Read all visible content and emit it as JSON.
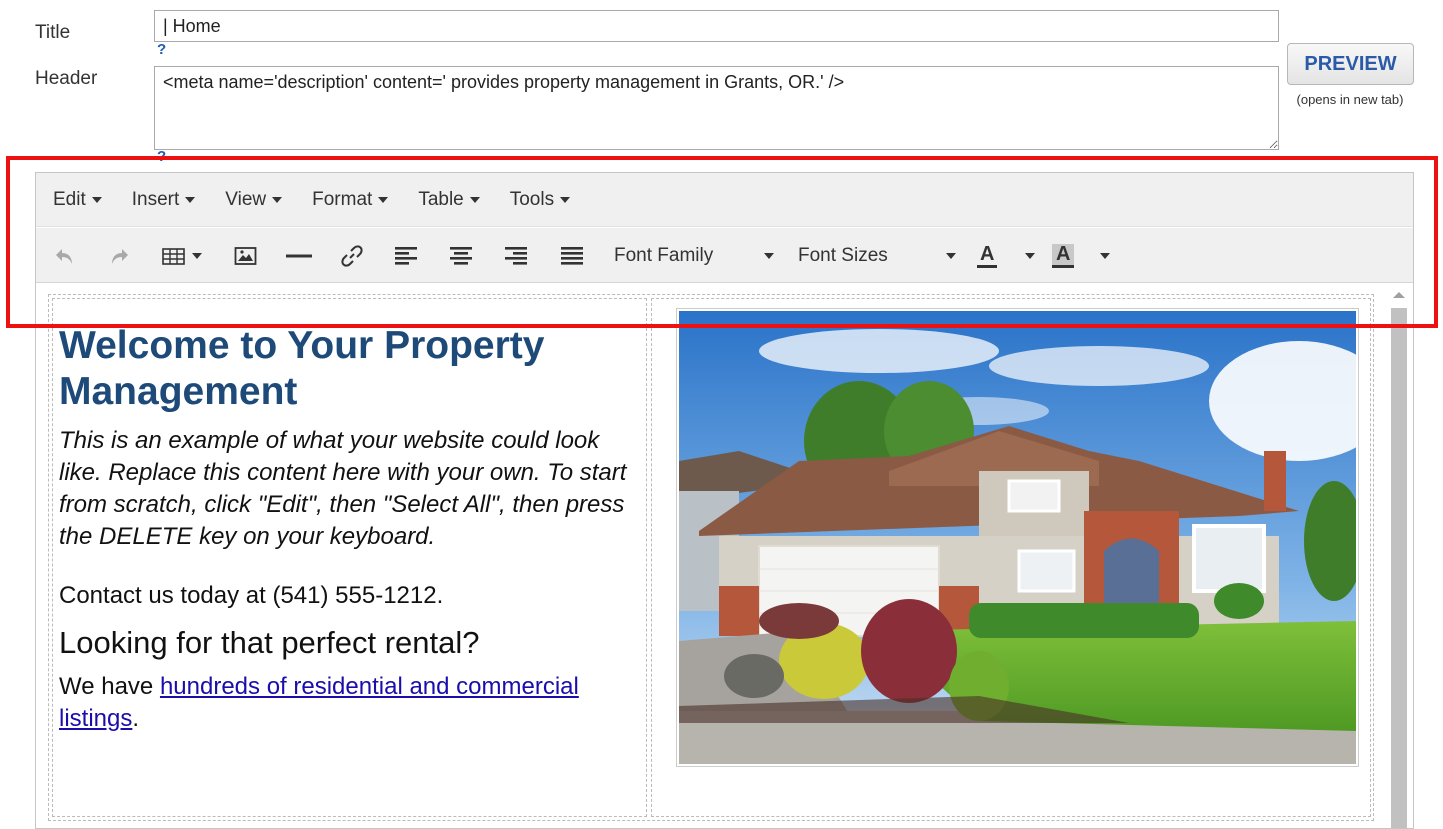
{
  "form": {
    "title_label": "Title",
    "title_value": "| Home",
    "header_label": "Header",
    "header_value": "<meta name='description' content=' provides property management in Grants, OR.' />",
    "help_mark": "?"
  },
  "preview": {
    "label": "PREVIEW",
    "note": "(opens in new tab)"
  },
  "menubar": {
    "items": [
      {
        "label": "Edit"
      },
      {
        "label": "Insert"
      },
      {
        "label": "View"
      },
      {
        "label": "Format"
      },
      {
        "label": "Table"
      },
      {
        "label": "Tools"
      }
    ]
  },
  "toolbar": {
    "font_family": "Font Family",
    "font_sizes": "Font Sizes",
    "text_color_letter": "A",
    "bg_color_letter": "A",
    "icons": [
      "undo-icon",
      "redo-icon",
      "table-icon",
      "image-icon",
      "horizontal-rule-icon",
      "link-icon",
      "align-left-icon",
      "align-center-icon",
      "align-right-icon",
      "align-justify-icon"
    ]
  },
  "content": {
    "heading": "Welcome to Your Property Management",
    "intro": "This is an example of what your website could look like. Replace this content here with your own. To start from scratch, click \"Edit\", then \"Select All\", then press the DELETE key on your keyboard.",
    "contact": "Contact us today at (541) 555-1212.",
    "subheading": "Looking for that perfect rental?",
    "listings_prefix": "We have ",
    "listings_link": "hundreds of residential and commercial listings",
    "listings_suffix": "."
  },
  "colors": {
    "highlight": "#ee1111",
    "heading": "#1d4a78",
    "link": "#1a0dab",
    "preview_text": "#2b5aa8"
  }
}
